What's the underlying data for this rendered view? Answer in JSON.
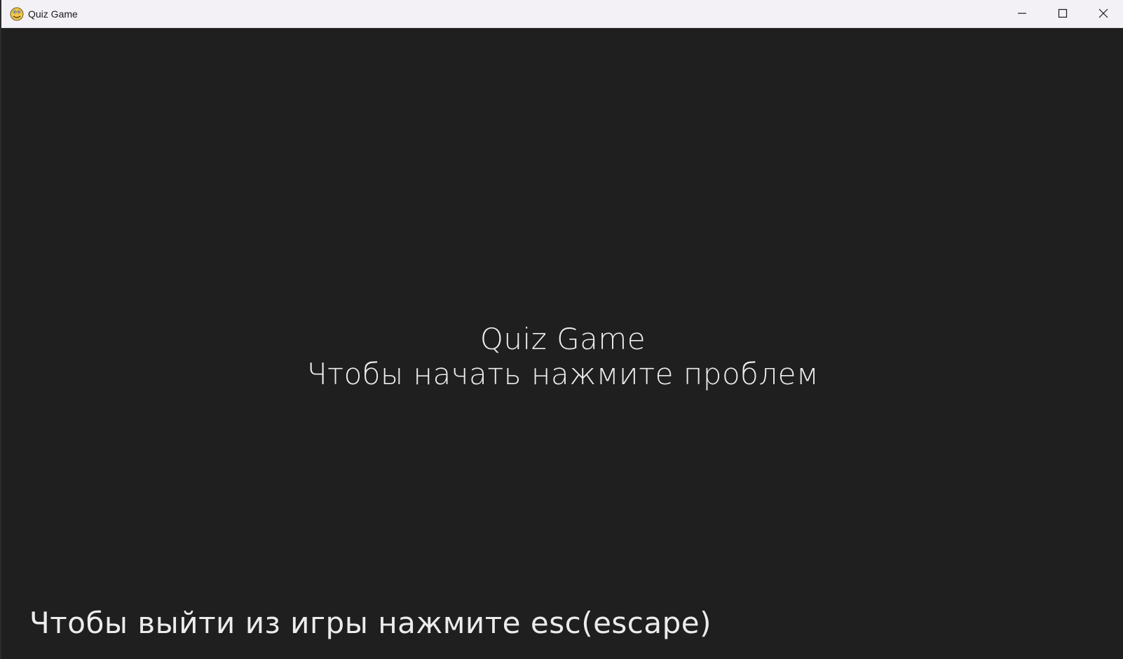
{
  "window": {
    "title": "Quiz Game",
    "app_icon": "pygame-snake-icon",
    "controls": {
      "minimize_icon": "minimize-icon",
      "maximize_icon": "maximize-icon",
      "close_icon": "close-icon"
    }
  },
  "game": {
    "title": "Quiz Game",
    "start_prompt": "Чтобы начать нажмите проблем",
    "exit_hint": "Чтобы выйти из игры нажмите esc(escape)"
  },
  "colors": {
    "background": "#1f1f1f",
    "text": "#ececec",
    "titlebar": "#f3f1f6"
  }
}
